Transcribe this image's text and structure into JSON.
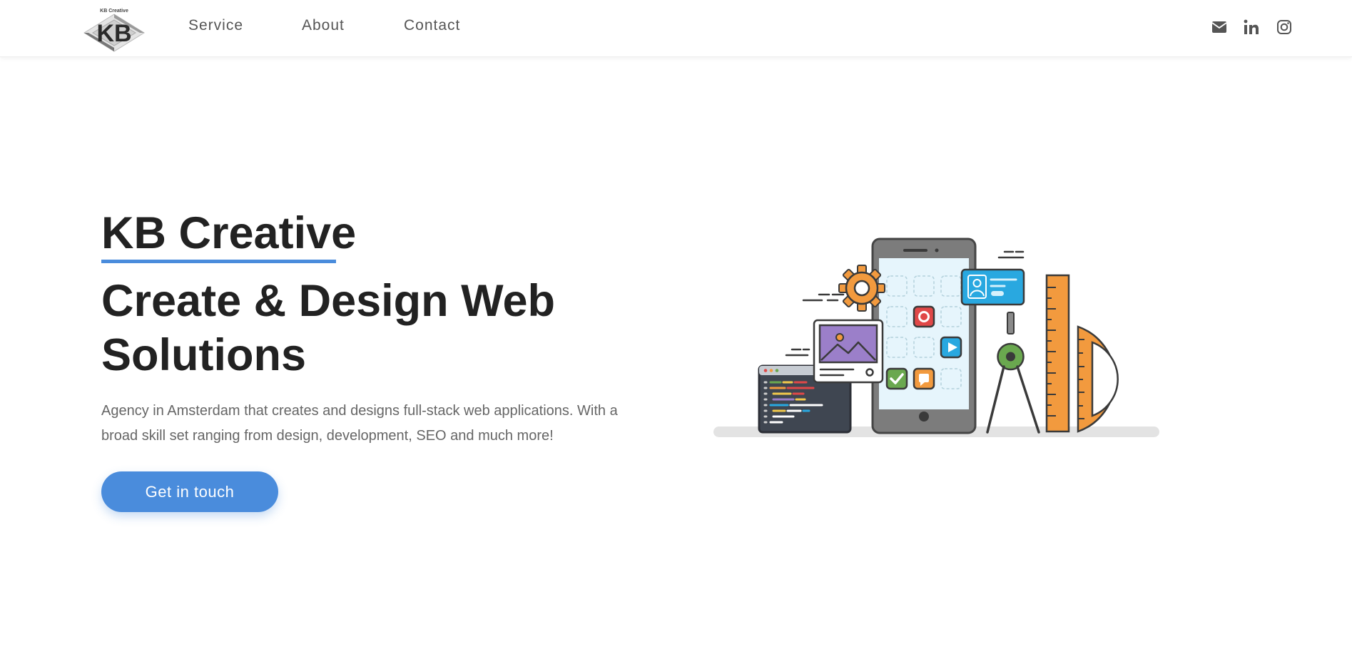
{
  "brand": {
    "logo_text": "KB Creative",
    "monogram": "KB"
  },
  "nav": {
    "links": [
      "Service",
      "About",
      "Contact"
    ]
  },
  "social": [
    "email-icon",
    "linkedin-icon",
    "instagram-icon"
  ],
  "hero": {
    "title": "KB Creative",
    "heading": "Create & Design Web Solutions",
    "description": "Agency in Amsterdam that creates and designs full-stack web applications. With a broad skill set ranging from design, development, SEO and much more!",
    "cta_label": "Get in touch"
  },
  "colors": {
    "accent": "#4a8cdc",
    "text_dark": "#222222",
    "text_muted": "#666666",
    "illustration_orange": "#f29a3e",
    "illustration_blue": "#29a8e0",
    "illustration_green": "#6aa84f",
    "illustration_red": "#e04848",
    "illustration_purple": "#9b7fc9"
  }
}
